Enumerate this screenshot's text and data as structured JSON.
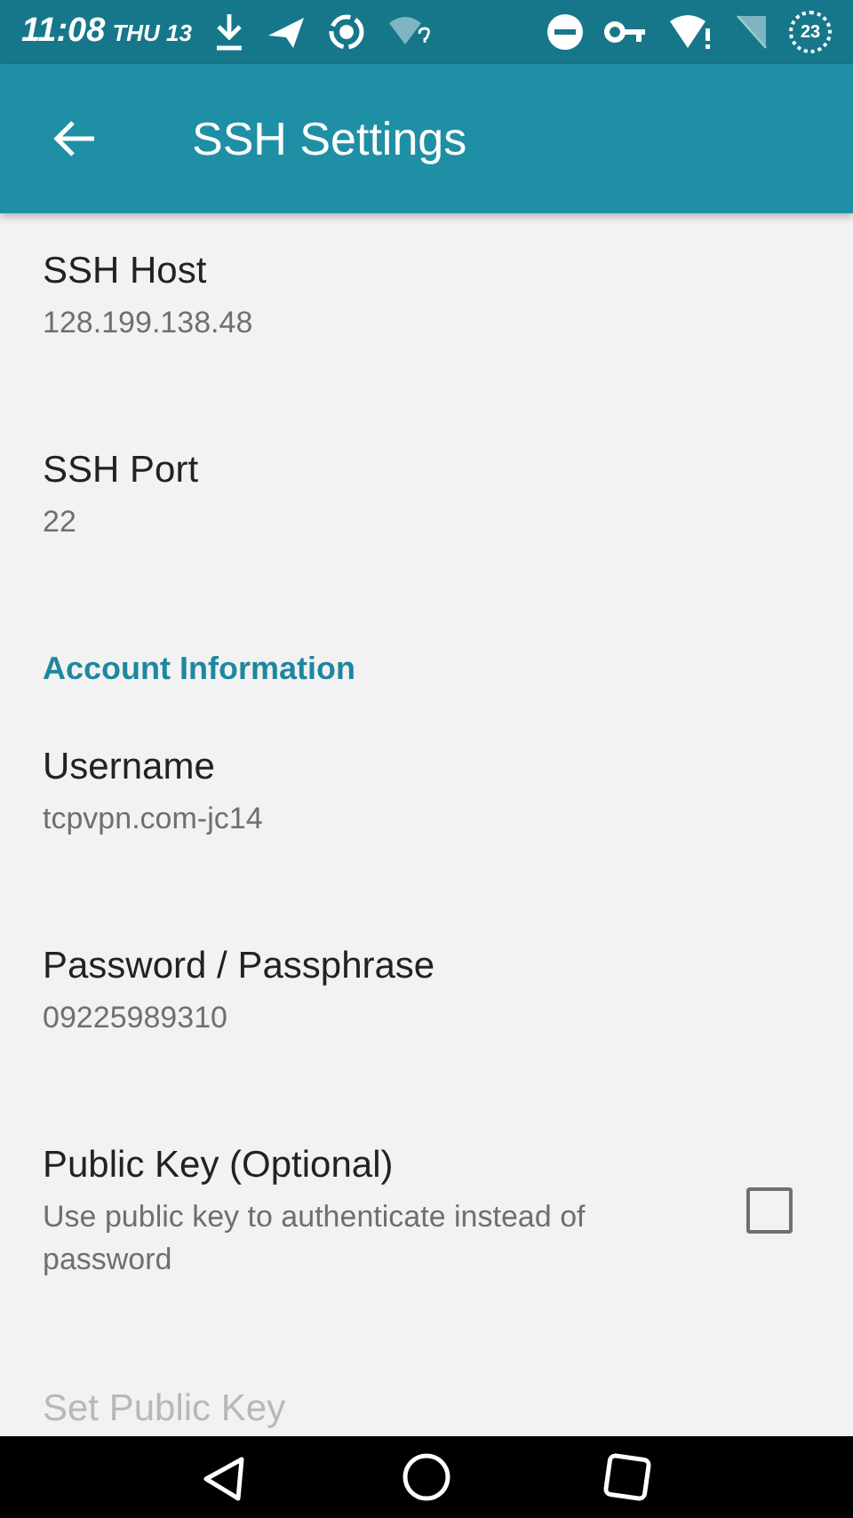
{
  "status_bar": {
    "time": "11:08",
    "day": "THU 13",
    "battery_badge": "23"
  },
  "app_bar": {
    "title": "SSH Settings"
  },
  "preferences": [
    {
      "kind": "item",
      "title": "SSH Host",
      "summary": "128.199.138.48",
      "disabled": false
    },
    {
      "kind": "item",
      "title": "SSH Port",
      "summary": "22",
      "disabled": false
    },
    {
      "kind": "category",
      "title": "Account Information"
    },
    {
      "kind": "item",
      "title": "Username",
      "summary": "tcpvpn.com-jc14",
      "disabled": false
    },
    {
      "kind": "item",
      "title": "Password / Passphrase",
      "summary": "09225989310",
      "disabled": false
    },
    {
      "kind": "checkbox",
      "title": "Public Key (Optional)",
      "summary": "Use public key to authenticate instead of password",
      "checked": false,
      "disabled": false
    },
    {
      "kind": "item",
      "title": "Set Public Key",
      "disabled": true
    }
  ]
}
